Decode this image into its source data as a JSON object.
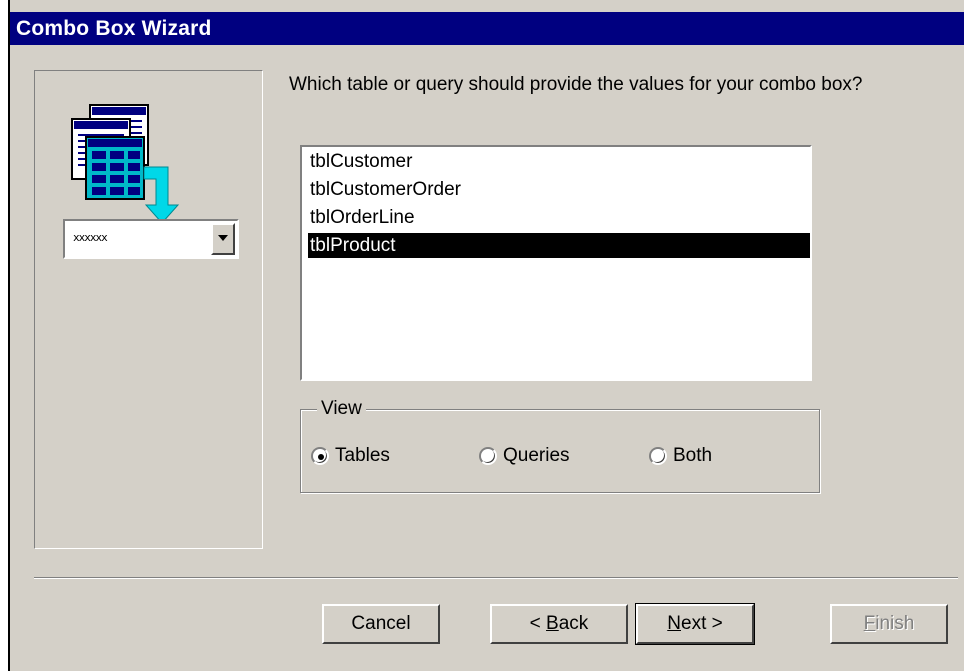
{
  "window": {
    "title": "Combo Box Wizard"
  },
  "main": {
    "question": "Which table or query should provide the values for your combo box?",
    "list_items": [
      {
        "label": "tblCustomer",
        "selected": false
      },
      {
        "label": "tblCustomerOrder",
        "selected": false
      },
      {
        "label": "tblOrderLine",
        "selected": false
      },
      {
        "label": "tblProduct",
        "selected": true
      }
    ],
    "view_group": {
      "legend": "View",
      "options": [
        {
          "label": "Tables",
          "checked": true
        },
        {
          "label": "Queries",
          "checked": false
        },
        {
          "label": "Both",
          "checked": false
        }
      ]
    }
  },
  "illustration": {
    "combo_value": "xxxxxx",
    "icon": "table-to-combo-icon"
  },
  "buttons": {
    "cancel": "Cancel",
    "back_prefix": "< ",
    "back_key": "B",
    "back_rest": "ack",
    "next_key": "N",
    "next_rest": "ext >",
    "finish_key": "F",
    "finish_rest": "inish"
  },
  "colors": {
    "titlebar": "#000080",
    "face": "#d4d0c8",
    "selection": "#000000",
    "accent_cyan": "#00b8c8"
  }
}
